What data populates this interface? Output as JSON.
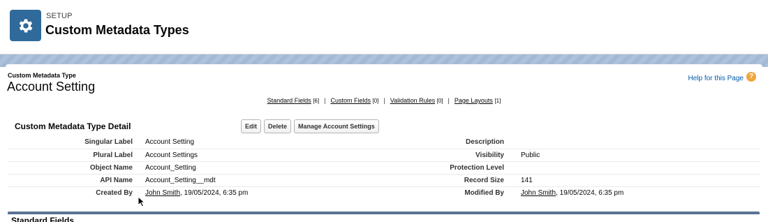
{
  "setup": {
    "eyebrow": "SETUP",
    "title": "Custom Metadata Types",
    "icon": "gear-icon"
  },
  "page": {
    "type_eyebrow": "Custom Metadata Type",
    "type_title": "Account Setting",
    "help_label": "Help for this Page",
    "help_icon": "?"
  },
  "related_links": [
    {
      "label": "Standard Fields",
      "count": "[6]"
    },
    {
      "label": "Custom Fields",
      "count": "[0]"
    },
    {
      "label": "Validation Rules",
      "count": "[0]"
    },
    {
      "label": "Page Layouts",
      "count": "[1]"
    }
  ],
  "related_sep": "|",
  "detail": {
    "title": "Custom Metadata Type Detail",
    "buttons": {
      "edit": "Edit",
      "delete": "Delete",
      "manage": "Manage Account Settings"
    },
    "rows": [
      {
        "l1": "Singular Label",
        "v1": "Account Setting",
        "l2": "Description",
        "v2": ""
      },
      {
        "l1": "Plural Label",
        "v1": "Account Settings",
        "l2": "Visibility",
        "v2": "Public"
      },
      {
        "l1": "Object Name",
        "v1": "Account_Setting",
        "l2": "Protection Level",
        "v2": ""
      },
      {
        "l1": "API Name",
        "v1": "Account_Setting__mdt",
        "l2": "Record Size",
        "v2": "141"
      }
    ],
    "created": {
      "label": "Created By",
      "user": "John Smith",
      "date": ", 19/05/2024, 6:35 pm"
    },
    "modified": {
      "label": "Modified By",
      "user": "John Smith",
      "date": ", 19/05/2024, 6:35 pm"
    }
  },
  "standard_fields": {
    "title": "Standard Fields"
  },
  "colors": {
    "tile": "#2f6a9a",
    "help_icon": "#f0a63d",
    "link": "#015ba7",
    "section_bar": "#5a7394"
  }
}
